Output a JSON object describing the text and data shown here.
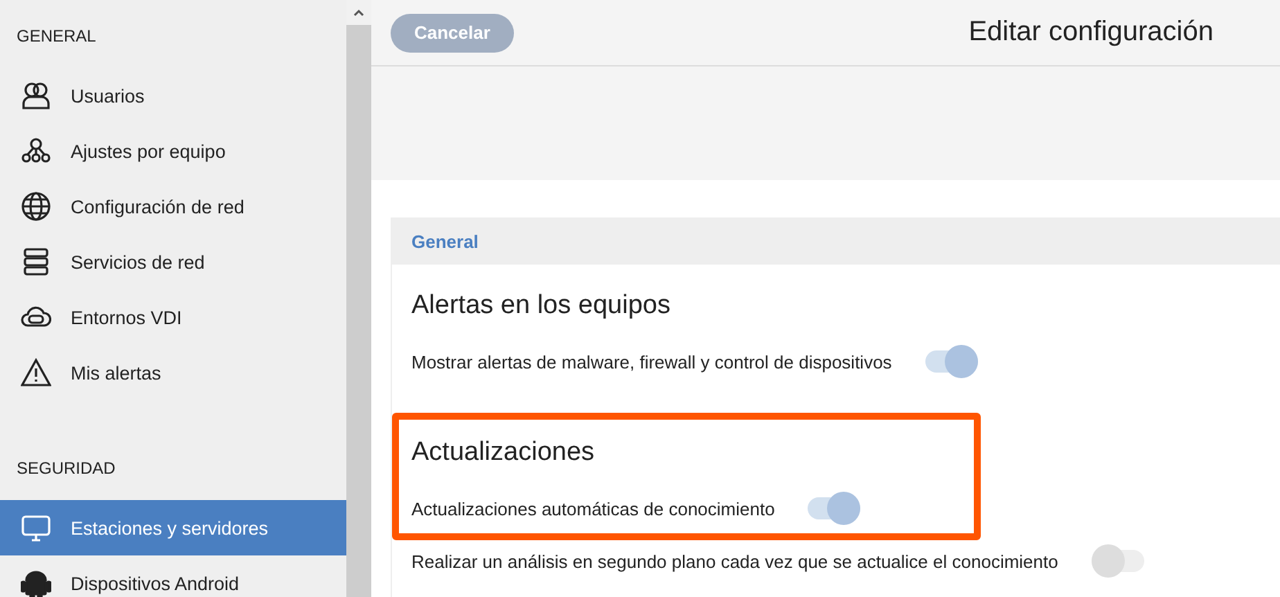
{
  "sidebar": {
    "sections": [
      {
        "title": "GENERAL",
        "items": [
          {
            "label": "Usuarios",
            "selected": false
          },
          {
            "label": "Ajustes por equipo",
            "selected": false
          },
          {
            "label": "Configuración de red",
            "selected": false
          },
          {
            "label": "Servicios de red",
            "selected": false
          },
          {
            "label": "Entornos VDI",
            "selected": false
          },
          {
            "label": "Mis alertas",
            "selected": false
          }
        ]
      },
      {
        "title": "SEGURIDAD",
        "items": [
          {
            "label": "Estaciones y servidores",
            "selected": true
          },
          {
            "label": "Dispositivos Android",
            "selected": false
          }
        ]
      }
    ]
  },
  "header": {
    "cancel_button": "Cancelar",
    "title": "Editar configuración"
  },
  "panel": {
    "title": "General",
    "groups": [
      {
        "heading": "Alertas en los equipos",
        "highlighted": false,
        "settings": [
          {
            "label": "Mostrar alertas de malware, firewall y control de dispositivos",
            "on": true
          }
        ]
      },
      {
        "heading": "Actualizaciones",
        "highlighted": true,
        "settings": [
          {
            "label": "Actualizaciones automáticas de conocimiento",
            "on": true
          }
        ]
      }
    ],
    "extra_settings": [
      {
        "label": "Realizar un análisis en segundo plano cada vez que se actualice el conocimiento",
        "on": false
      }
    ]
  }
}
